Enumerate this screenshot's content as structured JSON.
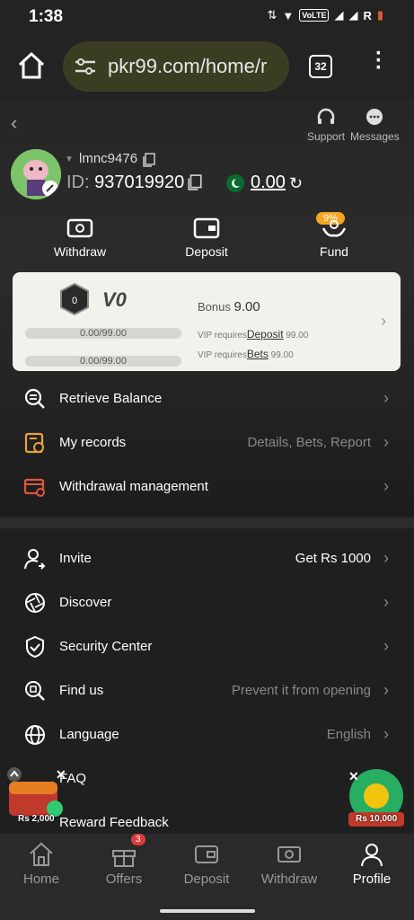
{
  "status_bar": {
    "time": "1:38",
    "network": "VoLTE",
    "carrier_letter": "R"
  },
  "browser": {
    "url": "pkr99.com/home/r",
    "tab_count": "32"
  },
  "header": {
    "support_label": "Support",
    "messages_label": "Messages",
    "username": "lmnc9476",
    "id_label": "ID:",
    "id_value": "937019920",
    "balance": "0.00"
  },
  "quick_actions": [
    {
      "label": "Withdraw"
    },
    {
      "label": "Deposit"
    },
    {
      "label": "Fund",
      "badge": "9%"
    }
  ],
  "vip": {
    "level": "V0",
    "progress_deposit": "0.00/99.00",
    "progress_bets": "0.00/99.00",
    "bonus_label": "Bonus",
    "bonus_value": "9.00",
    "req_prefix": "VIP requires",
    "deposit_link": "Deposit",
    "deposit_amount": "99.00",
    "bets_link": "Bets",
    "bets_amount": "99.00"
  },
  "menu_top": [
    {
      "label": "Retrieve Balance",
      "value": ""
    },
    {
      "label": "My records",
      "value": "Details, Bets, Report"
    },
    {
      "label": "Withdrawal management",
      "value": ""
    }
  ],
  "menu_bottom": [
    {
      "label": "Invite",
      "value": "Get Rs 1000"
    },
    {
      "label": "Discover",
      "value": ""
    },
    {
      "label": "Security Center",
      "value": ""
    },
    {
      "label": "Find us",
      "value": "Prevent it from opening"
    },
    {
      "label": "Language",
      "value": "English"
    },
    {
      "label": "FAQ",
      "value": ""
    },
    {
      "label": "Reward Feedback",
      "value": ""
    }
  ],
  "floats": {
    "left_amount": "Rs 2,000",
    "right_amount": "Rs 10,000"
  },
  "bottom_nav": [
    {
      "label": "Home"
    },
    {
      "label": "Offers",
      "badge": "3"
    },
    {
      "label": "Deposit"
    },
    {
      "label": "Withdraw"
    },
    {
      "label": "Profile"
    }
  ],
  "colors": {
    "accent_orange": "#f5a623",
    "records_icon": "#e8a23a",
    "withdraw_mgmt_icon": "#e2553d",
    "badge_red": "#e03b3b"
  }
}
